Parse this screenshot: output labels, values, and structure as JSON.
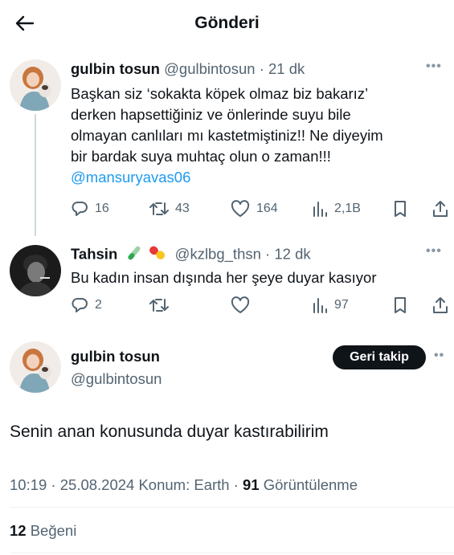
{
  "header": {
    "title": "Gönderi"
  },
  "tweet1": {
    "name": "gulbin tosun",
    "handle": "@gulbintosun",
    "time": "· 21 dk",
    "lines": [
      "Başkan siz ‘sokakta köpek olmaz biz bakarız’",
      "derken hapsettiğiniz ve önlerinde suyu bile",
      "olmayan canlıları mı kastetmiştiniz!!  Ne diyeyim",
      "bir bardak suya muhtaç olun o zaman!!!"
    ],
    "mention": "@mansuryavas06",
    "replies": "16",
    "retweets": "43",
    "likes": "164",
    "views": "2,1B"
  },
  "reply": {
    "name": "Tahsin",
    "handle": "@kzlbg_thsn",
    "time": "· 12 dk",
    "text": "Bu kadın insan dışında her şeye duyar kasıyor",
    "replies": "2",
    "views": "97"
  },
  "main": {
    "name": "gulbin tosun",
    "handle": "@gulbintosun",
    "follow_label": "Geri takip",
    "text": "Senin anan konusunda duyar kastırabilirim",
    "datetime": "10:19 · 25.08.2024 Konum: Earth ·",
    "views_count": "91",
    "views_label": "Görüntülenme",
    "likes_count": "12",
    "likes_label": "Beğeni"
  },
  "colors": {
    "link": "#1d9bf0",
    "muted": "#536471",
    "text": "#0f1419",
    "button": "#0f1419"
  }
}
